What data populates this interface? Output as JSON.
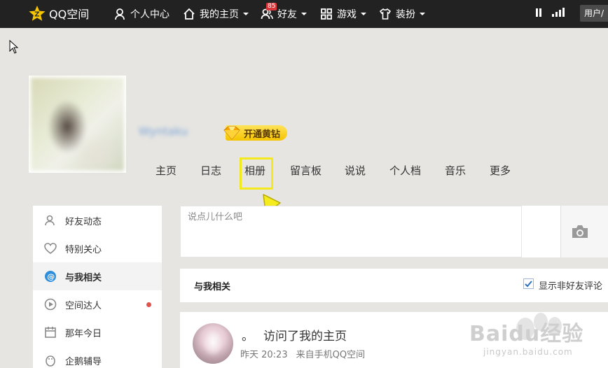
{
  "topbar": {
    "logo_text": "QQ空间",
    "items": [
      {
        "label": "个人中心",
        "icon": "person-icon",
        "dropdown": false
      },
      {
        "label": "我的主页",
        "icon": "home-icon",
        "dropdown": true
      },
      {
        "label": "好友",
        "icon": "friends-icon",
        "dropdown": true,
        "badge": "85"
      },
      {
        "label": "游戏",
        "icon": "grid-icon",
        "dropdown": true
      },
      {
        "label": "装扮",
        "icon": "shirt-icon",
        "dropdown": true
      }
    ],
    "user_button": "用户/"
  },
  "profile": {
    "username": "Wyntaku",
    "vip_label": "开通黄钻"
  },
  "profile_tabs": [
    "主页",
    "日志",
    "相册",
    "留言板",
    "说说",
    "个人档",
    "音乐",
    "更多"
  ],
  "highlighted_tab": "相册",
  "sidebar": {
    "items": [
      {
        "label": "好友动态",
        "icon": "friends-icon",
        "active": false
      },
      {
        "label": "特别关心",
        "icon": "heart-icon",
        "active": false
      },
      {
        "label": "与我相关",
        "icon": "at-icon",
        "active": true
      },
      {
        "label": "空间达人",
        "icon": "play-icon",
        "active": false,
        "dot": true
      },
      {
        "label": "那年今日",
        "icon": "calendar-icon",
        "active": false
      },
      {
        "label": "企鹅辅导",
        "icon": "penguin-icon",
        "active": false
      }
    ]
  },
  "composer": {
    "placeholder": "说点儿什么吧"
  },
  "section": {
    "title": "与我相关",
    "checkbox_label": "显示非好友评论",
    "checkbox_checked": true
  },
  "feed": {
    "dot": "。",
    "action": "访问了我的主页",
    "time": "昨天 20:23",
    "source": "来自手机QQ空间"
  },
  "watermark": {
    "main": "Baidu经验",
    "sub": "jingyan.baidu.com"
  },
  "colors": {
    "topbar": "#222222",
    "background": "#e6e5e2",
    "highlight": "#f2ea1e",
    "badge": "#d9373a",
    "vip": "#f5c300"
  }
}
